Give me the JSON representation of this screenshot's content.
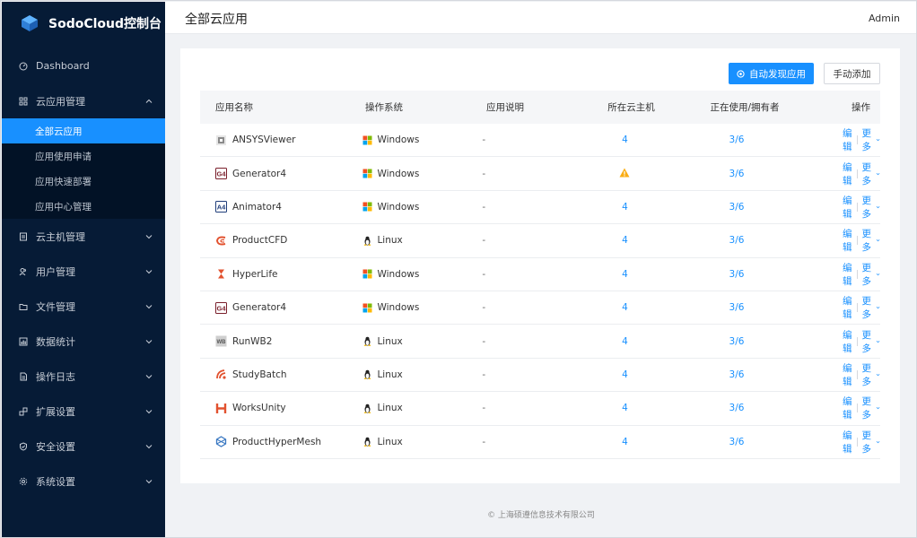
{
  "app": {
    "title": "SodoCloud控制台",
    "user": "Admin"
  },
  "header": {
    "page_title": "全部云应用"
  },
  "sidebar": {
    "items": [
      {
        "label": "Dashboard",
        "icon": "dashboard-icon",
        "has_chevron": false
      },
      {
        "label": "云应用管理",
        "icon": "apps-icon",
        "expanded": true,
        "children": [
          {
            "label": "全部云应用",
            "active": true
          },
          {
            "label": "应用使用申请",
            "active": false
          },
          {
            "label": "应用快速部署",
            "active": false
          },
          {
            "label": "应用中心管理",
            "active": false
          }
        ]
      },
      {
        "label": "云主机管理",
        "icon": "host-icon"
      },
      {
        "label": "用户管理",
        "icon": "users-icon"
      },
      {
        "label": "文件管理",
        "icon": "folder-icon"
      },
      {
        "label": "数据统计",
        "icon": "chart-icon"
      },
      {
        "label": "操作日志",
        "icon": "log-icon"
      },
      {
        "label": "扩展设置",
        "icon": "extension-icon"
      },
      {
        "label": "安全设置",
        "icon": "shield-icon"
      },
      {
        "label": "系统设置",
        "icon": "gear-icon"
      }
    ]
  },
  "toolbar": {
    "discover_label": "自动发现应用",
    "add_label": "手动添加"
  },
  "table": {
    "headers": {
      "name": "应用名称",
      "os": "操作系统",
      "desc": "应用说明",
      "host": "所在云主机",
      "usage": "正在使用/拥有者",
      "ops": "操作"
    },
    "edit_label": "编辑",
    "more_label": "更多",
    "rows": [
      {
        "name": "ANSYSViewer",
        "icon": "ansys-icon",
        "os": "Windows",
        "desc": "-",
        "host": "4",
        "host_warning": false,
        "usage": "3/6"
      },
      {
        "name": "Generator4",
        "icon": "generator-icon",
        "os": "Windows",
        "desc": "-",
        "host": "",
        "host_warning": true,
        "usage": "3/6"
      },
      {
        "name": "Animator4",
        "icon": "animator-icon",
        "os": "Windows",
        "desc": "-",
        "host": "4",
        "host_warning": false,
        "usage": "3/6"
      },
      {
        "name": "ProductCFD",
        "icon": "productcfd-icon",
        "os": "Linux",
        "desc": "-",
        "host": "4",
        "host_warning": false,
        "usage": "3/6"
      },
      {
        "name": "HyperLife",
        "icon": "hyperlife-icon",
        "os": "Windows",
        "desc": "-",
        "host": "4",
        "host_warning": false,
        "usage": "3/6"
      },
      {
        "name": "Generator4",
        "icon": "generator-icon",
        "os": "Windows",
        "desc": "-",
        "host": "4",
        "host_warning": false,
        "usage": "3/6"
      },
      {
        "name": "RunWB2",
        "icon": "runwb2-icon",
        "os": "Linux",
        "desc": "-",
        "host": "4",
        "host_warning": false,
        "usage": "3/6"
      },
      {
        "name": "StudyBatch",
        "icon": "studybatch-icon",
        "os": "Linux",
        "desc": "-",
        "host": "4",
        "host_warning": false,
        "usage": "3/6"
      },
      {
        "name": "WorksUnity",
        "icon": "worksunity-icon",
        "os": "Linux",
        "desc": "-",
        "host": "4",
        "host_warning": false,
        "usage": "3/6"
      },
      {
        "name": "ProductHyperMesh",
        "icon": "producthypermesh-icon",
        "os": "Linux",
        "desc": "-",
        "host": "4",
        "host_warning": false,
        "usage": "3/6"
      }
    ]
  },
  "footer": {
    "text": "© 上海硕遵信息技术有限公司"
  },
  "colors": {
    "accent": "#1890ff",
    "sidebar": "#061b36",
    "warning": "#faad14"
  }
}
